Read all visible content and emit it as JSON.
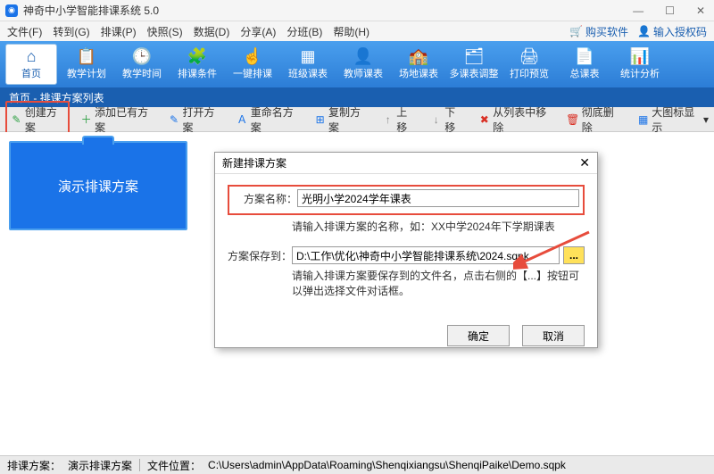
{
  "titlebar": {
    "title": "神奇中小学智能排课系统 5.0"
  },
  "menubar": {
    "items": [
      "文件(F)",
      "转到(G)",
      "排课(P)",
      "快照(S)",
      "数据(D)",
      "分享(A)",
      "分班(B)",
      "帮助(H)"
    ],
    "buy": "购买软件",
    "auth": "输入授权码"
  },
  "toolbar": {
    "items": [
      {
        "icon": "⌂",
        "label": "首页"
      },
      {
        "icon": "📋",
        "label": "教学计划"
      },
      {
        "icon": "🕒",
        "label": "教学时间"
      },
      {
        "icon": "🧩",
        "label": "排课条件"
      },
      {
        "icon": "☝",
        "label": "一键排课"
      },
      {
        "icon": "▦",
        "label": "班级课表"
      },
      {
        "icon": "👤",
        "label": "教师课表"
      },
      {
        "icon": "🏫",
        "label": "场地课表"
      },
      {
        "icon": "🗂",
        "label": "多课表调整"
      },
      {
        "icon": "🖨",
        "label": "打印预览"
      },
      {
        "icon": "📄",
        "label": "总课表"
      },
      {
        "icon": "📊",
        "label": "统计分析"
      }
    ]
  },
  "breadcrumb": "首页 - 排课方案列表",
  "subtoolbar": {
    "create": "创建方案",
    "addExisting": "添加已有方案",
    "open": "打开方案",
    "rename": "重命名方案",
    "copy": "复制方案",
    "moveUp": "上移",
    "moveDown": "下移",
    "remove": "从列表中移除",
    "delete": "彻底删除",
    "viewMode": "大图标显示"
  },
  "card": {
    "title": "演示排课方案"
  },
  "modal": {
    "title": "新建排课方案",
    "nameLabel": "方案名称：",
    "nameValue": "光明小学2024学年课表",
    "nameHint": "请输入排课方案的名称，如：XX中学2024年下学期课表",
    "pathLabel": "方案保存到：",
    "pathValue": "D:\\工作\\优化\\神奇中小学智能排课系统\\2024.sqpk",
    "browseLabel": "...",
    "pathHint": "请输入排课方案要保存到的文件名，点击右侧的【...】按钮可以弹出选择文件对话框。",
    "ok": "确定",
    "cancel": "取消"
  },
  "statusbar": {
    "schemeLabel": "排课方案：",
    "schemeValue": "演示排课方案",
    "pathLabel": "文件位置：",
    "pathValue": "C:\\Users\\admin\\AppData\\Roaming\\Shenqixiangsu\\ShenqiPaike\\Demo.sqpk"
  }
}
